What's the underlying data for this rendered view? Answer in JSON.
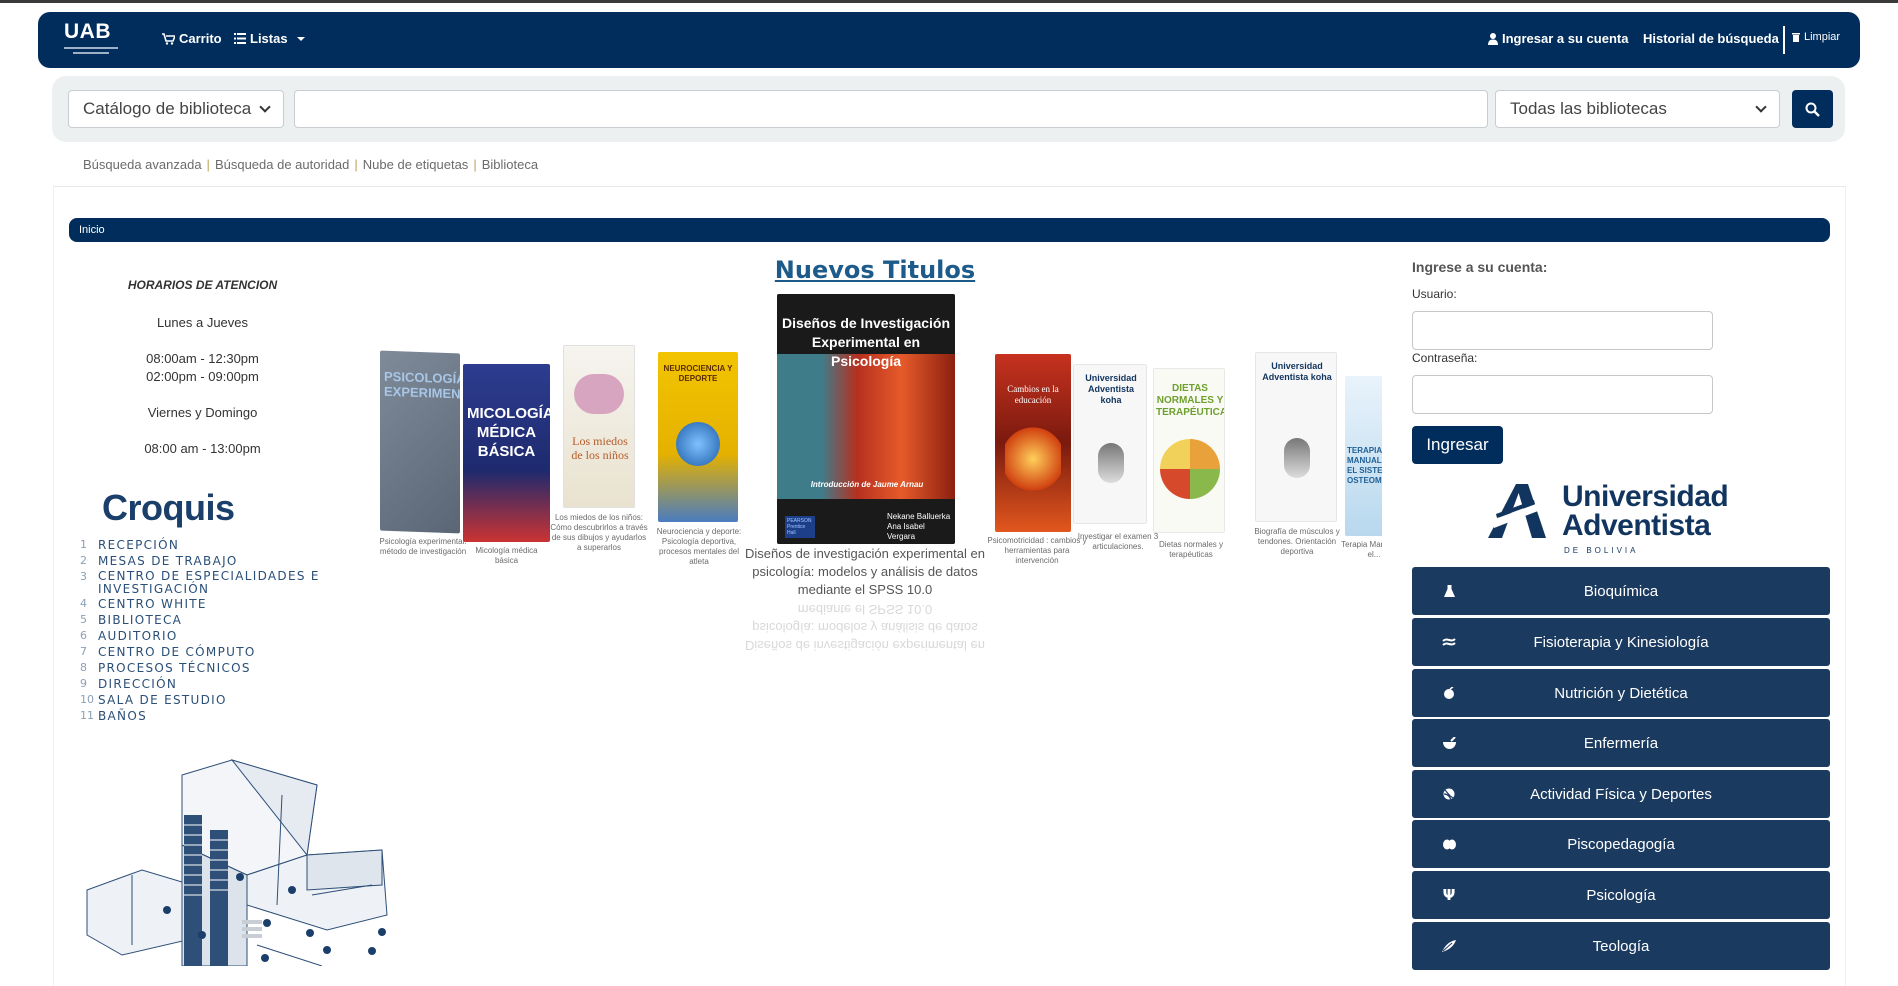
{
  "navbar": {
    "logo_text": "UAB",
    "cart_label": "Carrito",
    "lists_label": "Listas",
    "login_label": "Ingresar a su cuenta",
    "history_label": "Historial de búsqueda",
    "clear_label": "Limpiar"
  },
  "search": {
    "catalog_selected": "Catálogo de biblioteca",
    "query_value": "",
    "library_selected": "Todas las bibliotecas"
  },
  "links": [
    "Búsqueda avanzada",
    "Búsqueda de autoridad",
    "Nube de etiquetas",
    "Biblioteca"
  ],
  "breadcrumb": {
    "home": "Inicio"
  },
  "hours": {
    "title": "HORARIOS DE ATENCION",
    "days1": "Lunes a Jueves",
    "slot1": "08:00am - 12:30pm",
    "slot2": "02:00pm - 09:00pm",
    "days2": "Viernes y Domingo",
    "slot3": "08:00 am - 13:00pm"
  },
  "croquis": {
    "title": "Croquis",
    "items": [
      {
        "n": "1",
        "t": "RECEPCIÓN"
      },
      {
        "n": "2",
        "t": "MESAS DE TRABAJO"
      },
      {
        "n": "3",
        "t": "CENTRO DE ESPECIALIDADES E INVESTIGACIÓN"
      },
      {
        "n": "4",
        "t": "CENTRO WHITE"
      },
      {
        "n": "5",
        "t": "BIBLIOTECA"
      },
      {
        "n": "6",
        "t": "AUDITORIO"
      },
      {
        "n": "7",
        "t": "CENTRO DE CÓMPUTO"
      },
      {
        "n": "8",
        "t": "PROCESOS TÉCNICOS"
      },
      {
        "n": "9",
        "t": "DIRECCIÓN"
      },
      {
        "n": "10",
        "t": "SALA DE ESTUDIO"
      },
      {
        "n": "11",
        "t": "BAÑOS"
      }
    ]
  },
  "new_titles": {
    "heading": "Nuevos Titulos",
    "featured": {
      "cover_title": "Diseños de Investigación Experimental en Psicología",
      "cover_sub": "Introducción de Jaume Arnau",
      "authors": "Nekane Balluerka\nAna Isabel Vergara",
      "publisher": "PEARSON Prentice Hall",
      "caption": "Diseños de investigación experimental en psicología: modelos y análisis de datos mediante el SPSS 10.0"
    },
    "books": [
      {
        "cover": "PSICOLOGÍA EXPERIMENTAL",
        "caption": "Psicología experimental: método de investigación"
      },
      {
        "cover": "MICOLOGÍA MÉDICA BÁSICA",
        "caption": "Micología médica básica"
      },
      {
        "cover": "Los miedos de los niños",
        "caption": "Los miedos de los niños: Cómo descubrirlos a través de sus dibujos y ayudarlos a superarlos"
      },
      {
        "cover": "NEUROCIENCIA Y DEPORTE",
        "caption": "Neurociencia y deporte: Psicología deportiva, procesos mentales del atleta"
      },
      {
        "cover": "Cambios en la educación",
        "caption": "Psicomotricidad : cambios y herramientas para intervención"
      },
      {
        "cover": "Universidad Adventista koha",
        "caption": "Investigar el examen 3 articulaciones."
      },
      {
        "cover": "DIETAS NORMALES Y TERAPÉUTICAS",
        "caption": "Dietas normales y terapéuticas"
      },
      {
        "cover": "Universidad Adventista koha",
        "caption": "Biografía de músculos y tendones. Orientación deportiva"
      },
      {
        "cover": "TERAPIA MANUAL EN EL SISTEMA OSTEOMIOARTICULAR",
        "caption": "Terapia Manual en el..."
      }
    ]
  },
  "login": {
    "title": "Ingrese a su cuenta:",
    "user_label": "Usuario:",
    "pass_label": "Contraseña:",
    "button": "Ingresar"
  },
  "university": {
    "name_line1": "Universidad",
    "name_line2": "Adventista",
    "sub": "DE BOLIVIA"
  },
  "categories": [
    {
      "label": "Bioquímica",
      "icon": "flask-icon"
    },
    {
      "label": "Fisioterapia y Kinesiología",
      "icon": "bandage-icon"
    },
    {
      "label": "Nutrición y Dietética",
      "icon": "apple-icon"
    },
    {
      "label": "Enfermería",
      "icon": "mortar-icon"
    },
    {
      "label": "Actividad Física y Deportes",
      "icon": "ball-icon"
    },
    {
      "label": "Piscopedagogía",
      "icon": "brain-icon"
    },
    {
      "label": "Psicología",
      "icon": "psi-icon"
    },
    {
      "label": "Teología",
      "icon": "feather-icon"
    }
  ],
  "colors": {
    "primary": "#002d5b",
    "category_bg": "#1b3a5f",
    "link_separator": "#c1a05d",
    "heading_link": "#1c5b8a"
  }
}
